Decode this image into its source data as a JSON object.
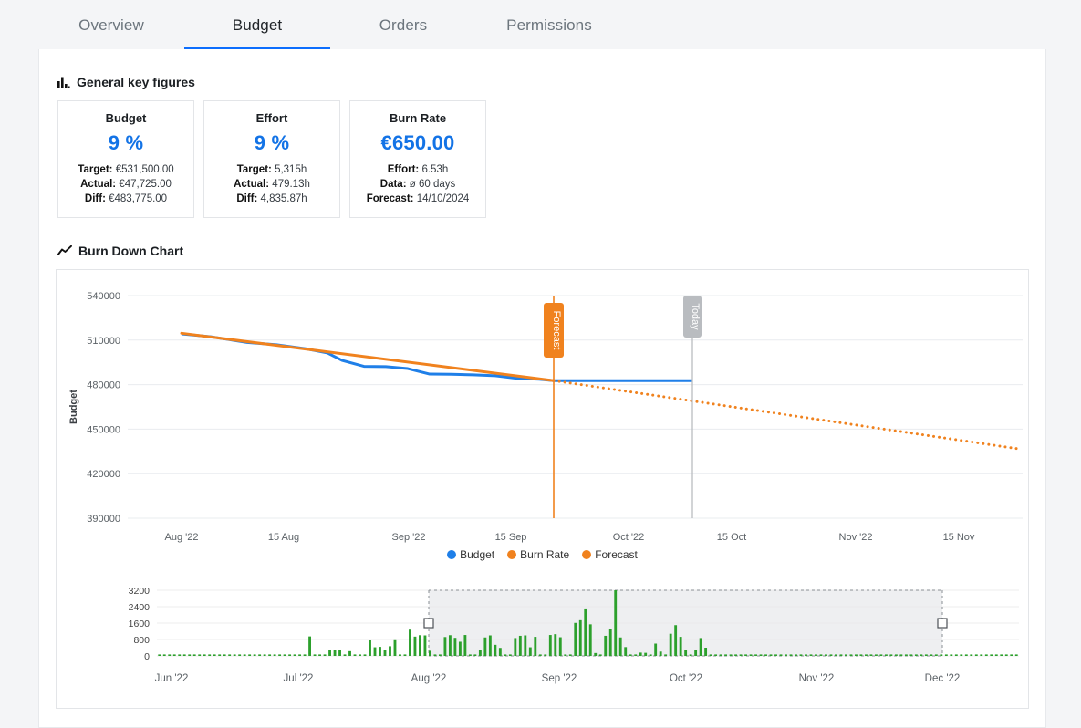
{
  "tabs": [
    {
      "label": "Overview",
      "active": false
    },
    {
      "label": "Budget",
      "active": true
    },
    {
      "label": "Orders",
      "active": false
    },
    {
      "label": "Permissions",
      "active": false
    }
  ],
  "sections": {
    "kpi_heading": "General key figures",
    "kpi_icon": "bar-chart-icon",
    "chart_heading": "Burn Down Chart",
    "chart_icon": "trending-up-icon"
  },
  "kpi_cards": [
    {
      "title": "Budget",
      "value": "9 %",
      "rows": [
        {
          "label": "Target:",
          "value": "€531,500.00"
        },
        {
          "label": "Actual:",
          "value": "€47,725.00"
        },
        {
          "label": "Diff:",
          "value": "€483,775.00"
        }
      ]
    },
    {
      "title": "Effort",
      "value": "9 %",
      "rows": [
        {
          "label": "Target:",
          "value": "5,315h"
        },
        {
          "label": "Actual:",
          "value": "479.13h"
        },
        {
          "label": "Diff:",
          "value": "4,835.87h"
        }
      ]
    },
    {
      "title": "Burn Rate",
      "value": "€650.00",
      "rows": [
        {
          "label": "Effort:",
          "value": "6.53h"
        },
        {
          "label": "Data:",
          "value": "ø 60 days"
        },
        {
          "label": "Forecast:",
          "value": "14/10/2024"
        }
      ]
    }
  ],
  "colors": {
    "budget": "#1f7fe8",
    "burn_rate": "#f0821e",
    "forecast": "#f0821e",
    "navigator_bar": "#2ca02c",
    "accent": "#0d6efd",
    "today_marker": "#b9bcc0",
    "grid": "#e9ecef"
  },
  "chart_data": {
    "type": "line",
    "title": "Burn Down Chart",
    "xlabel": "",
    "ylabel": "Budget",
    "ylim": [
      390000,
      540000
    ],
    "yticks": [
      540000,
      510000,
      480000,
      450000,
      420000,
      390000
    ],
    "xticks": [
      "Aug '22",
      "15 Aug",
      "Sep '22",
      "15 Sep",
      "Oct '22",
      "15 Oct",
      "Nov '22",
      "15 Nov"
    ],
    "grid": true,
    "legend_position": "bottom",
    "legend": [
      "Budget",
      "Burn Rate",
      "Forecast"
    ],
    "annotations": [
      {
        "label": "Forecast",
        "type": "vertical-line",
        "x": "21 Sep '22",
        "color": "#f0821e"
      },
      {
        "label": "Today",
        "type": "vertical-line",
        "x": "10 Oct '22",
        "color": "#b9bcc0"
      }
    ],
    "series": [
      {
        "name": "Budget",
        "style": "solid",
        "color": "#1f7fe8",
        "x": [
          "Aug '22",
          "5 Aug",
          "10 Aug",
          "14 Aug",
          "18 Aug",
          "21 Aug",
          "23 Aug",
          "26 Aug",
          "29 Aug",
          "1 Sep",
          "4 Sep",
          "7 Sep",
          "10 Sep",
          "13 Sep",
          "16 Sep",
          "19 Sep",
          "21 Sep",
          "27 Sep",
          "4 Oct",
          "10 Oct"
        ],
        "values": [
          514200,
          512300,
          508400,
          506900,
          504200,
          501300,
          496300,
          492300,
          492100,
          490800,
          487100,
          487000,
          486600,
          486000,
          484200,
          483600,
          482700,
          482700,
          482700,
          482700
        ]
      },
      {
        "name": "Burn Rate",
        "style": "solid",
        "color": "#f0821e",
        "x": [
          "Aug '22",
          "21 Sep"
        ],
        "values": [
          514600,
          482700
        ]
      },
      {
        "name": "Forecast",
        "style": "dotted",
        "color": "#f0821e",
        "x": [
          "21 Sep",
          "30 Nov"
        ],
        "values": [
          482700,
          436500
        ]
      }
    ]
  },
  "navigator": {
    "type": "bar",
    "ylim": [
      0,
      3200
    ],
    "yticks": [
      3200,
      2400,
      1600,
      800,
      0
    ],
    "xticks": [
      "Jun '22",
      "Jul '22",
      "Aug '22",
      "Sep '22",
      "Oct '22",
      "Nov '22",
      "Dec '22"
    ],
    "color": "#2ca02c",
    "selection": {
      "from": "Aug '22",
      "to": "Dec '22"
    },
    "values": [
      0,
      0,
      0,
      0,
      0,
      0,
      0,
      0,
      0,
      0,
      0,
      0,
      0,
      0,
      0,
      0,
      0,
      0,
      0,
      0,
      0,
      0,
      0,
      0,
      0,
      0,
      0,
      0,
      0,
      0,
      950,
      0,
      0,
      0,
      290,
      300,
      310,
      0,
      230,
      0,
      0,
      0,
      800,
      420,
      440,
      280,
      470,
      810,
      0,
      0,
      1280,
      940,
      1010,
      1000,
      250,
      0,
      0,
      920,
      1010,
      880,
      690,
      1020,
      0,
      0,
      270,
      900,
      1000,
      540,
      390,
      0,
      0,
      870,
      980,
      1000,
      420,
      930,
      0,
      0,
      1020,
      1060,
      910,
      0,
      0,
      1610,
      1740,
      2270,
      1540,
      140,
      0,
      980,
      1290,
      3200,
      900,
      430,
      0,
      0,
      160,
      150,
      0,
      600,
      210,
      0,
      1080,
      1500,
      930,
      300,
      0,
      270,
      870,
      400,
      0,
      0,
      0,
      0,
      0,
      0,
      0,
      0,
      0,
      0,
      0,
      0,
      0,
      0,
      0,
      0,
      0,
      0,
      0,
      0,
      0,
      0,
      0,
      0,
      0,
      0,
      0,
      0,
      0,
      0,
      0,
      0,
      0,
      0,
      0,
      0,
      0,
      0,
      0,
      0,
      0,
      0,
      0,
      0,
      0,
      0,
      0,
      0,
      0,
      0,
      0,
      0,
      0,
      0,
      0,
      0,
      0,
      0,
      0,
      0,
      0,
      0
    ]
  }
}
